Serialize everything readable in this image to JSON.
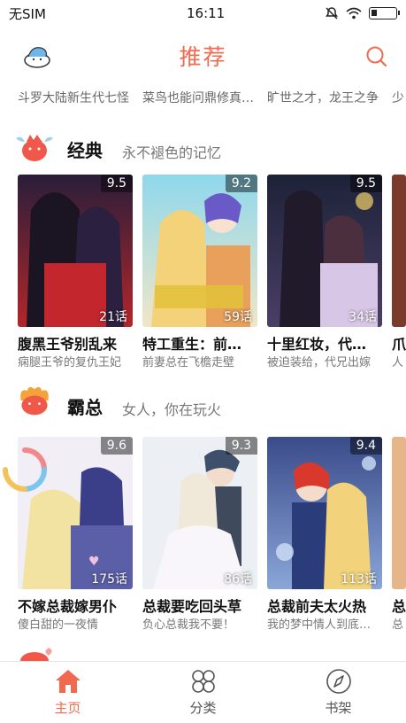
{
  "status_bar": {
    "carrier": "无SIM",
    "time": "16:11"
  },
  "header": {
    "title": "推荐"
  },
  "previous_row": {
    "items": [
      "斗罗大陆新生代七怪",
      "菜鸟也能问鼎修真…",
      "旷世之才，龙王之争",
      "少"
    ]
  },
  "sections": [
    {
      "title": "经典",
      "subtitle": "永不褪色的记忆",
      "cards": [
        {
          "score": "9.5",
          "episodes": "21话",
          "title": "腹黑王爷别乱来",
          "desc": "痫腿王爷的复仇王妃"
        },
        {
          "score": "9.2",
          "episodes": "59话",
          "title": "特工重生：前…",
          "desc": "前妻总在飞檐走壁"
        },
        {
          "score": "9.5",
          "episodes": "34话",
          "title": "十里红妆，代…",
          "desc": "被迫装给，代兄出嫁"
        },
        {
          "title": "爪",
          "desc": "人"
        }
      ]
    },
    {
      "title": "霸总",
      "subtitle": "女人，你在玩火",
      "cards": [
        {
          "score": "9.6",
          "episodes": "175话",
          "title": "不嫁总裁嫁男仆",
          "desc": "傻白甜的一夜情"
        },
        {
          "score": "9.3",
          "episodes": "86话",
          "title": "总裁要吃回头草",
          "desc": "负心总裁我不要！"
        },
        {
          "score": "9.4",
          "episodes": "113话",
          "title": "总裁前夫太火热",
          "desc": "我的梦中情人到底…"
        },
        {
          "title": "总",
          "desc": "总"
        }
      ]
    }
  ],
  "bottom_nav": [
    {
      "label": "主页",
      "icon": "home-icon",
      "active": true
    },
    {
      "label": "分类",
      "icon": "grid-icon",
      "active": false
    },
    {
      "label": "书架",
      "icon": "compass-icon",
      "active": false
    }
  ],
  "colors": {
    "accent": "#f06a4f",
    "text": "#111111",
    "muted": "#777777"
  }
}
